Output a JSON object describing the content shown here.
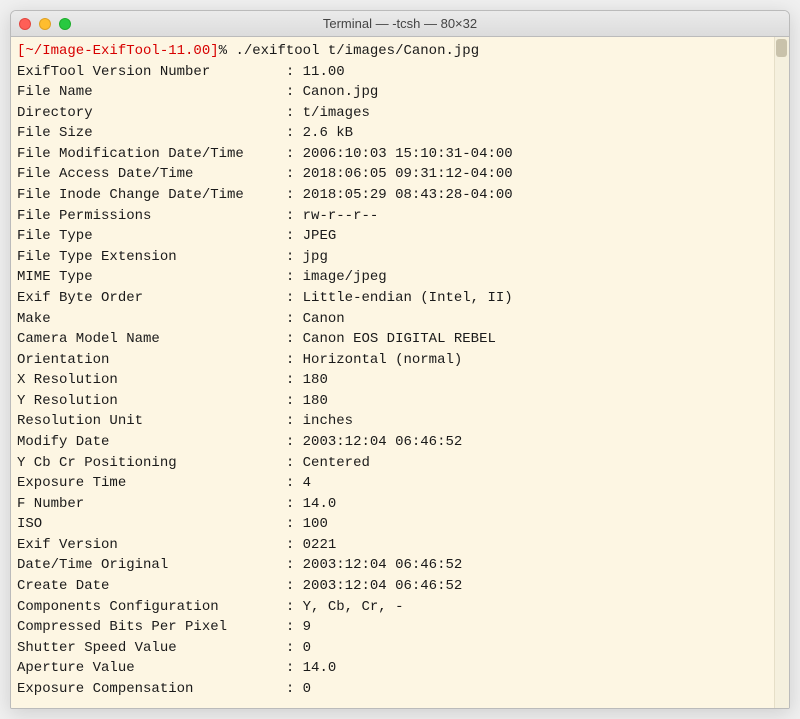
{
  "window": {
    "title": "Terminal — -tcsh — 80×32"
  },
  "prompt": {
    "path": "[~/Image-ExifTool-11.00]",
    "symbol": "%",
    "command": "./exiftool t/images/Canon.jpg"
  },
  "rows": [
    {
      "label": "ExifTool Version Number",
      "value": "11.00"
    },
    {
      "label": "File Name",
      "value": "Canon.jpg"
    },
    {
      "label": "Directory",
      "value": "t/images"
    },
    {
      "label": "File Size",
      "value": "2.6 kB"
    },
    {
      "label": "File Modification Date/Time",
      "value": "2006:10:03 15:10:31-04:00"
    },
    {
      "label": "File Access Date/Time",
      "value": "2018:06:05 09:31:12-04:00"
    },
    {
      "label": "File Inode Change Date/Time",
      "value": "2018:05:29 08:43:28-04:00"
    },
    {
      "label": "File Permissions",
      "value": "rw-r--r--"
    },
    {
      "label": "File Type",
      "value": "JPEG"
    },
    {
      "label": "File Type Extension",
      "value": "jpg"
    },
    {
      "label": "MIME Type",
      "value": "image/jpeg"
    },
    {
      "label": "Exif Byte Order",
      "value": "Little-endian (Intel, II)"
    },
    {
      "label": "Make",
      "value": "Canon"
    },
    {
      "label": "Camera Model Name",
      "value": "Canon EOS DIGITAL REBEL"
    },
    {
      "label": "Orientation",
      "value": "Horizontal (normal)"
    },
    {
      "label": "X Resolution",
      "value": "180"
    },
    {
      "label": "Y Resolution",
      "value": "180"
    },
    {
      "label": "Resolution Unit",
      "value": "inches"
    },
    {
      "label": "Modify Date",
      "value": "2003:12:04 06:46:52"
    },
    {
      "label": "Y Cb Cr Positioning",
      "value": "Centered"
    },
    {
      "label": "Exposure Time",
      "value": "4"
    },
    {
      "label": "F Number",
      "value": "14.0"
    },
    {
      "label": "ISO",
      "value": "100"
    },
    {
      "label": "Exif Version",
      "value": "0221"
    },
    {
      "label": "Date/Time Original",
      "value": "2003:12:04 06:46:52"
    },
    {
      "label": "Create Date",
      "value": "2003:12:04 06:46:52"
    },
    {
      "label": "Components Configuration",
      "value": "Y, Cb, Cr, -"
    },
    {
      "label": "Compressed Bits Per Pixel",
      "value": "9"
    },
    {
      "label": "Shutter Speed Value",
      "value": "0"
    },
    {
      "label": "Aperture Value",
      "value": "14.0"
    },
    {
      "label": "Exposure Compensation",
      "value": "0"
    }
  ],
  "layout": {
    "label_width": 32
  }
}
